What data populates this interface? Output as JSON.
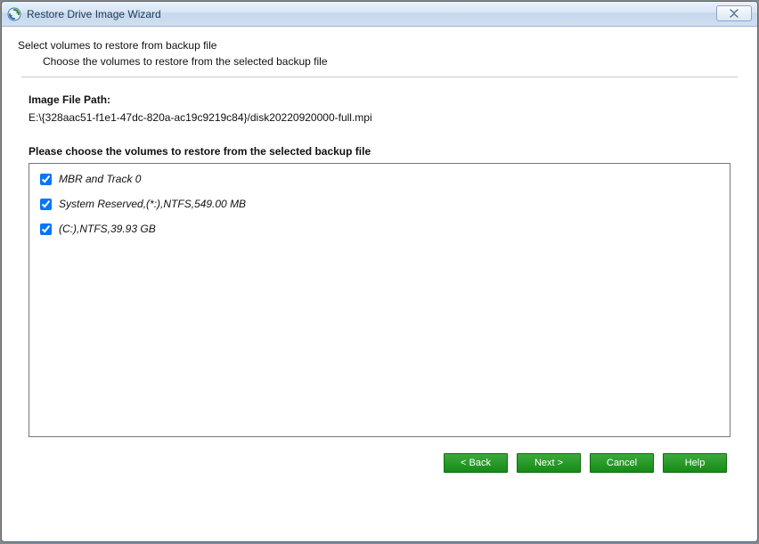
{
  "window": {
    "title": "Restore Drive Image Wizard"
  },
  "intro": {
    "heading": "Select volumes to restore from backup file",
    "sub": "Choose the volumes to restore from the selected backup file"
  },
  "image_path": {
    "label": "Image File Path:",
    "value": "E:\\{328aac51-f1e1-47dc-820a-ac19c9219c84}/disk20220920000-full.mpi"
  },
  "choose_label": "Please choose the volumes to restore from the selected backup file",
  "volumes": [
    {
      "label": "MBR and Track 0",
      "checked": true
    },
    {
      "label": "System Reserved,(*:),NTFS,549.00 MB",
      "checked": true
    },
    {
      "label": "(C:),NTFS,39.93 GB",
      "checked": true
    }
  ],
  "buttons": {
    "back": "< Back",
    "next": "Next >",
    "cancel": "Cancel",
    "help": "Help"
  }
}
